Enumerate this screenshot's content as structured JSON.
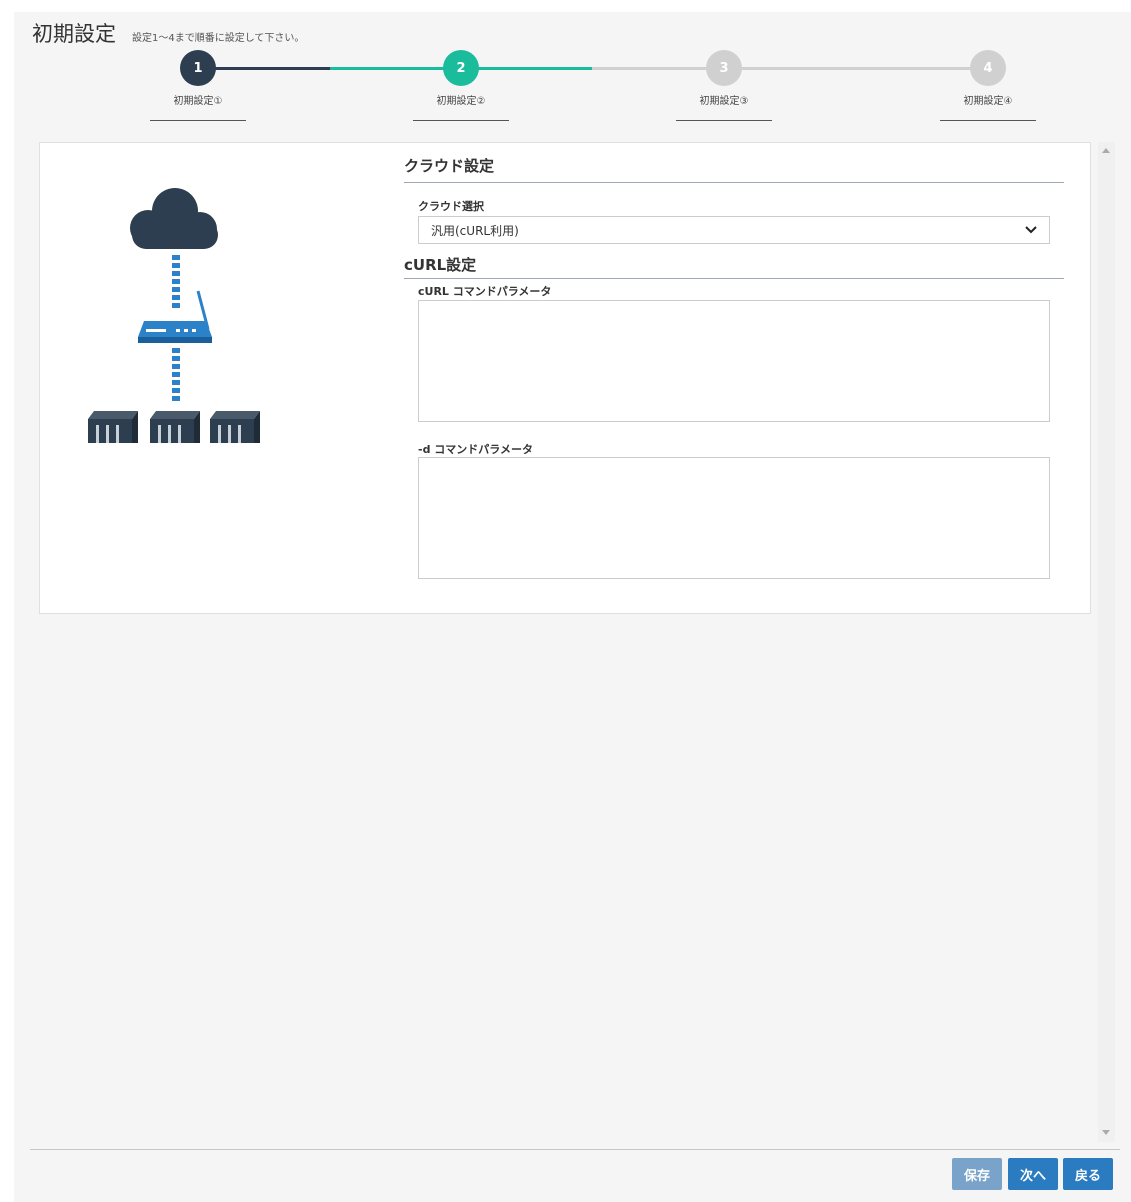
{
  "header": {
    "title": "初期設定",
    "subtitle": "設定1～4まで順番に設定して下さい。"
  },
  "stepper": {
    "steps": [
      {
        "number": "1",
        "label": "初期設定①",
        "state": "done"
      },
      {
        "number": "2",
        "label": "初期設定②",
        "state": "active"
      },
      {
        "number": "3",
        "label": "初期設定③",
        "state": "pending"
      },
      {
        "number": "4",
        "label": "初期設定④",
        "state": "pending"
      }
    ]
  },
  "cloud": {
    "section_title": "クラウド設定",
    "select_label": "クラウド選択",
    "select_value": "汎用(cURL利用)"
  },
  "curl": {
    "section_title": "cURL設定",
    "command_label": "cURL コマンドパラメータ",
    "command_value": "",
    "d_label": "-d コマンドパラメータ",
    "d_value": ""
  },
  "buttons": {
    "save": "保存",
    "next": "次へ",
    "back": "戻る"
  },
  "colors": {
    "step_done": "#2c3e50",
    "step_active": "#1abc9c",
    "step_pending": "#d0d0d0",
    "button_primary": "#2b7bc0",
    "button_disabled": "#7aa3c9",
    "diagram_blue": "#2b82c9"
  }
}
